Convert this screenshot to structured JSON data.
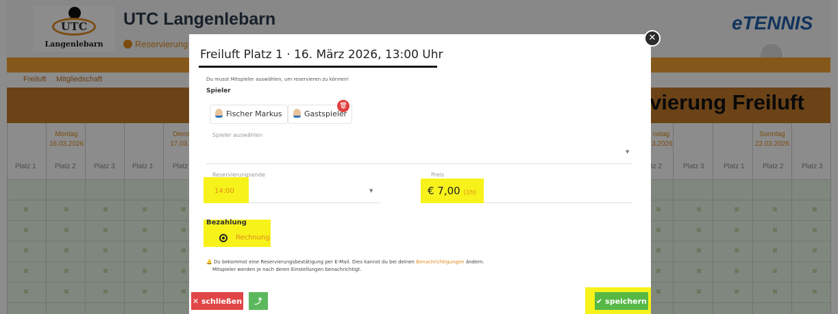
{
  "background": {
    "club_name": "UTC Langenlebarn",
    "logo_text": "UTC",
    "logo_subtext": "Langenlebarn",
    "reservation_link": "Reservierung",
    "brand": "eTENNIS",
    "nav_items": [
      "Freiluft",
      "Mitgliedschaft"
    ],
    "page_heading": "rvierung Freiluft",
    "days": [
      {
        "name": "Montag",
        "date": "16.03.2026"
      },
      {
        "name": "Diens",
        "date": "17.03.2"
      },
      {
        "name": "nstag",
        "date": ".3.2026"
      },
      {
        "name": "Sonntag",
        "date": "22.03.2026"
      }
    ],
    "courts": [
      "Platz 1",
      "Platz 2",
      "Platz 3",
      "Platz 1",
      "Platz",
      "tz 2",
      "Platz 3",
      "Platz 1",
      "Platz 2",
      "Platz 3"
    ]
  },
  "modal": {
    "title": "Freiluft Platz 1 · 16. März 2026, 13:00 Uhr",
    "hint": "Du musst Mitspieler auswählen, um reservieren zu können!",
    "players_label": "Spieler",
    "players": [
      "Fischer Markus",
      "Gastspieler"
    ],
    "select_player_placeholder": "Spieler auswählen",
    "reservation_end_label": "Reservierungsende",
    "reservation_end_value": "14:00",
    "price_label": "Preis",
    "price_value": "€ 7,00",
    "price_duration": "(1h)",
    "payment_label": "Bezahlung",
    "payment_option": "Rechnung",
    "info_line1_a": "Du bekommst eine Reservierungsbestätigung per E-Mail. Dies kannst du bei deinen ",
    "info_line1_link": "Benachrichtigungen",
    "info_line1_b": " ändern.",
    "info_line2": "Mitspieler werden je nach deren Einstellungen benachrichtigt.",
    "close_button": "schließen",
    "save_button": "speichern"
  },
  "colors": {
    "highlight": "#f7f21a",
    "accent": "#e08a1c",
    "danger": "#e04646",
    "success": "#57b846"
  }
}
